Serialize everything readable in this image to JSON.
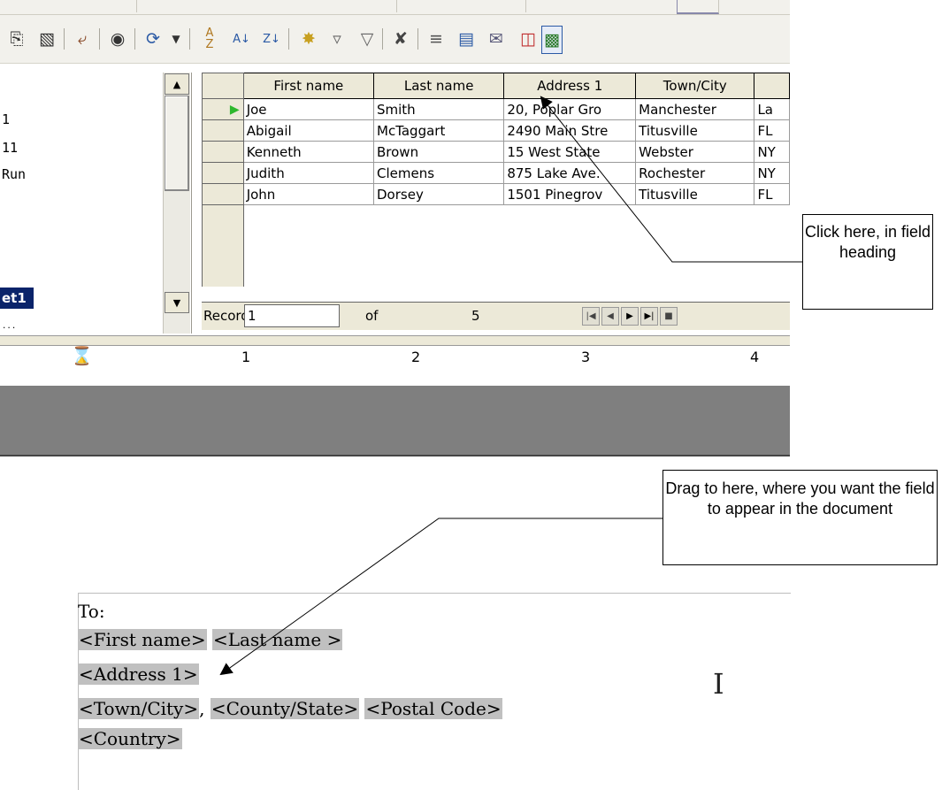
{
  "toolbar": {
    "icons": [
      "paste-icon",
      "paste-special-icon",
      "undo-icon",
      "find-icon",
      "redo-icon",
      "sort-icon",
      "sort-ascending-icon",
      "sort-descending-icon",
      "autofilter-icon",
      "standard-filter-icon",
      "apply-filter-icon",
      "remove-filter-icon",
      "data-to-text-icon",
      "data-to-fields-icon",
      "mail-merge-icon",
      "data-source-icon",
      "explorer-icon"
    ]
  },
  "tree": {
    "items": [
      "1",
      "11",
      "Run"
    ],
    "selected": "et1",
    "partial": "..."
  },
  "grid": {
    "columns": [
      "First name",
      "Last name",
      "Address 1",
      "Town/City",
      ""
    ],
    "rows": [
      [
        "Joe",
        "Smith",
        "20, Poplar Gro",
        "Manchester",
        "La"
      ],
      [
        "Abigail",
        "McTaggart",
        "2490 Main Stre",
        "Titusville",
        "FL"
      ],
      [
        "Kenneth",
        "Brown",
        "15 West State",
        "Webster",
        "NY"
      ],
      [
        "Judith",
        "Clemens",
        "875 Lake Ave.",
        "Rochester",
        "NY"
      ],
      [
        "John",
        "Dorsey",
        "1501 Pinegrov",
        "Titusville",
        "FL"
      ]
    ],
    "current_row": 0
  },
  "navbar": {
    "record_label": "Record",
    "record_value": "1",
    "of_label": "of",
    "total": "5"
  },
  "ruler": {
    "numbers": [
      "1",
      "2",
      "3",
      "4"
    ]
  },
  "document": {
    "line1": "To:",
    "first_name": "<First name>",
    "last_name": "<Last name >",
    "address1": "<Address 1>",
    "town_city": "<Town/City>",
    "comma": ",",
    "county_state": "<County/State>",
    "postal_code": "<Postal Code>",
    "country": "<Country>"
  },
  "callouts": {
    "click_here": "Click here, in field heading",
    "drag_here": "Drag to here, where you want the field to appear in the document"
  }
}
